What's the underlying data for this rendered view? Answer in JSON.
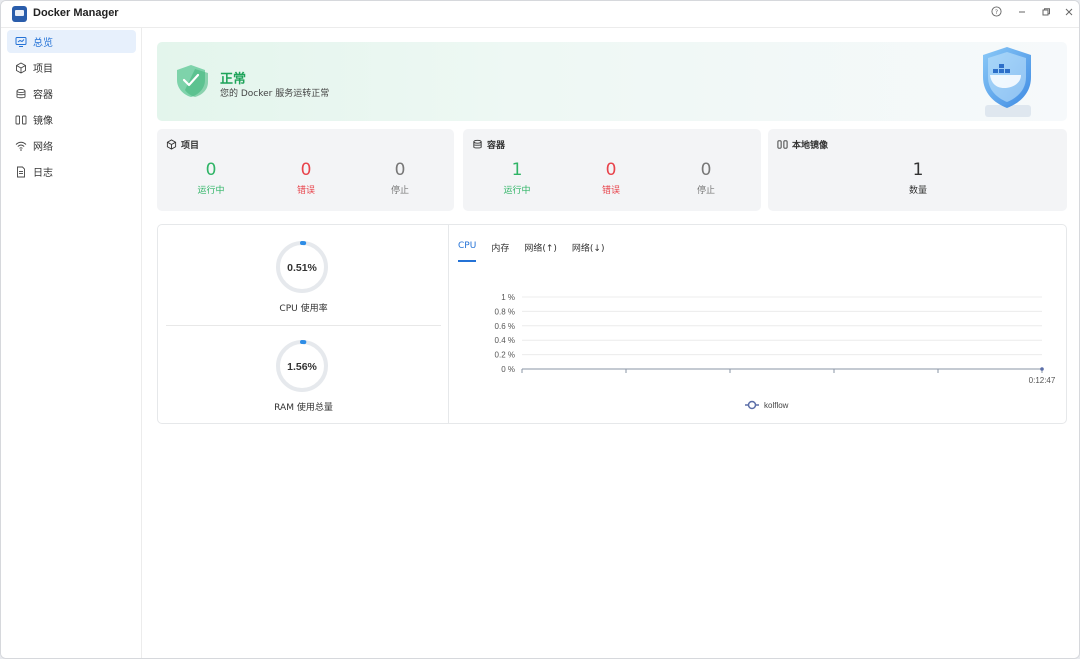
{
  "window": {
    "title": "Docker Manager",
    "controls": {
      "help": "?",
      "minimize": "–",
      "restore": "❐",
      "close": "✕"
    }
  },
  "sidebar": {
    "items": [
      {
        "label": "总览",
        "icon": "monitor-icon",
        "active": true
      },
      {
        "label": "项目",
        "icon": "cube-icon",
        "active": false
      },
      {
        "label": "容器",
        "icon": "database-icon",
        "active": false
      },
      {
        "label": "镜像",
        "icon": "columns-icon",
        "active": false
      },
      {
        "label": "网络",
        "icon": "wifi-icon",
        "active": false
      },
      {
        "label": "日志",
        "icon": "document-icon",
        "active": false
      }
    ]
  },
  "banner": {
    "title": "正常",
    "subtitle": "您的 Docker 服务运转正常"
  },
  "cards": {
    "projects": {
      "title": "项目",
      "stats": [
        {
          "value": "0",
          "label": "运行中",
          "color": "#2fb466"
        },
        {
          "value": "0",
          "label": "错误",
          "color": "#e8434b"
        },
        {
          "value": "0",
          "label": "停止",
          "color": "#777777"
        }
      ]
    },
    "containers": {
      "title": "容器",
      "stats": [
        {
          "value": "1",
          "label": "运行中",
          "color": "#2fb466"
        },
        {
          "value": "0",
          "label": "错误",
          "color": "#e8434b"
        },
        {
          "value": "0",
          "label": "停止",
          "color": "#777777"
        }
      ]
    },
    "images": {
      "title": "本地镜像",
      "stats": [
        {
          "value": "1",
          "label": "数量",
          "color": "#333333"
        }
      ]
    }
  },
  "usage": {
    "cpu": {
      "value_text": "0.51%",
      "fraction": 0.0051,
      "label": "CPU 使用率"
    },
    "ram": {
      "value_text": "1.56%",
      "fraction": 0.0156,
      "label": "RAM 使用总量"
    }
  },
  "tabs": [
    {
      "label": "CPU",
      "active": true
    },
    {
      "label": "内存",
      "active": false
    },
    {
      "label": "网络(↑)",
      "active": false
    },
    {
      "label": "网络(↓)",
      "active": false
    }
  ],
  "colors": {
    "accent": "#2472d6",
    "running": "#2fb466",
    "error": "#e8434b",
    "stopped": "#777777",
    "gauge_track": "#e6e9ed",
    "gauge_fill": "#2e8de6"
  },
  "chart_data": {
    "type": "line",
    "y_ticks": [
      "1 %",
      "0.8 %",
      "0.6 %",
      "0.4 %",
      "0.2 %",
      "0 %"
    ],
    "ylim": [
      0,
      1
    ],
    "x": [
      "0:12:47"
    ],
    "series": [
      {
        "name": "kolflow",
        "values": [
          0
        ]
      }
    ],
    "legend": "bottom-center",
    "grid": true
  }
}
